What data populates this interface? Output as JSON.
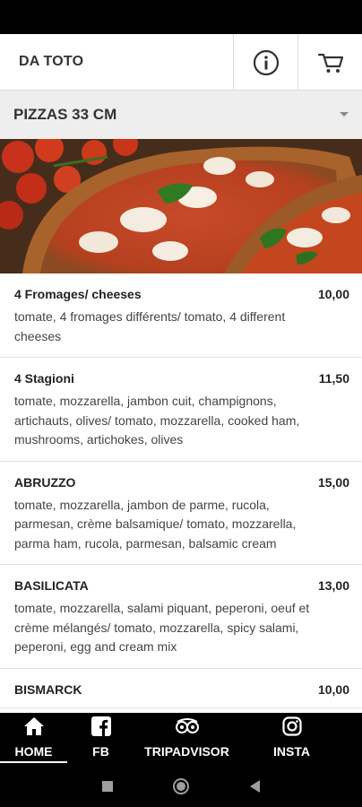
{
  "header": {
    "title": "DA TOTO",
    "info_icon": "info-icon",
    "cart_icon": "cart-icon"
  },
  "category": {
    "label": "PIZZAS 33 CM"
  },
  "menu_items": [
    {
      "name": "4 Fromages/ cheeses",
      "price": "10,00",
      "description": "tomate, 4 fromages différents/ tomato, 4 different cheeses"
    },
    {
      "name": "4 Stagioni",
      "price": "11,50",
      "description": "tomate, mozzarella, jambon cuit, champignons, artichauts, olives/ tomato, mozzarella, cooked ham, mushrooms, artichokes, olives"
    },
    {
      "name": "ABRUZZO",
      "price": "15,00",
      "description": "tomate, mozzarella, jambon de parme, rucola, parmesan, crème balsamique/ tomato, mozzarella, parma ham, rucola, parmesan, balsamic cream"
    },
    {
      "name": "BASILICATA",
      "price": "13,00",
      "description": "tomate, mozzarella, salami piquant, peperoni, oeuf et crème mélangés/ tomato, mozzarella, spicy salami, peperoni, egg and cream mix"
    },
    {
      "name": "BISMARCK",
      "price": "10,00",
      "description": ""
    }
  ],
  "bottom_nav": [
    {
      "label": "HOME",
      "icon": "home-icon",
      "active": true
    },
    {
      "label": "FB",
      "icon": "facebook-icon",
      "active": false
    },
    {
      "label": "TRIPADVISOR",
      "icon": "tripadvisor-icon",
      "active": false
    },
    {
      "label": "INSTA",
      "icon": "instagram-icon",
      "active": false
    }
  ],
  "colors": {
    "header_bg": "#ffffff",
    "category_bg": "#eeeeee",
    "nav_bg": "#000000",
    "text": "#222222"
  }
}
